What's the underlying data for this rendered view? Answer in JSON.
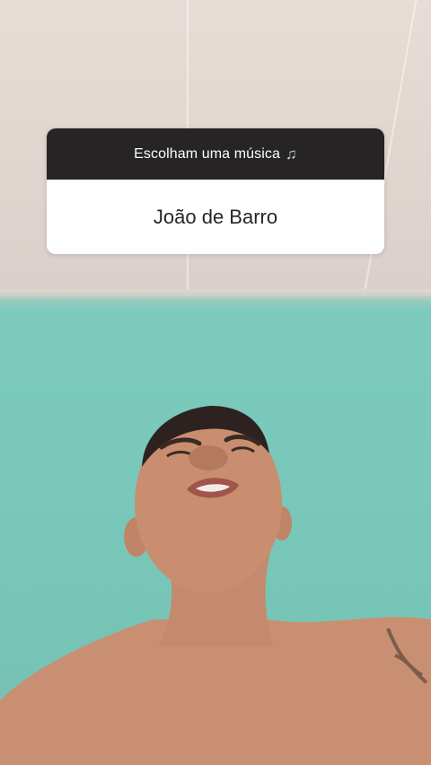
{
  "question_sticker": {
    "question": "Escolham uma música",
    "question_icon": "musical-notes-icon",
    "answer": "João de Barro"
  },
  "colors": {
    "header_bg": "#262424",
    "answer_bg": "#ffffff",
    "wall": "#7ccbbd",
    "ceiling": "#e2d6d0"
  }
}
